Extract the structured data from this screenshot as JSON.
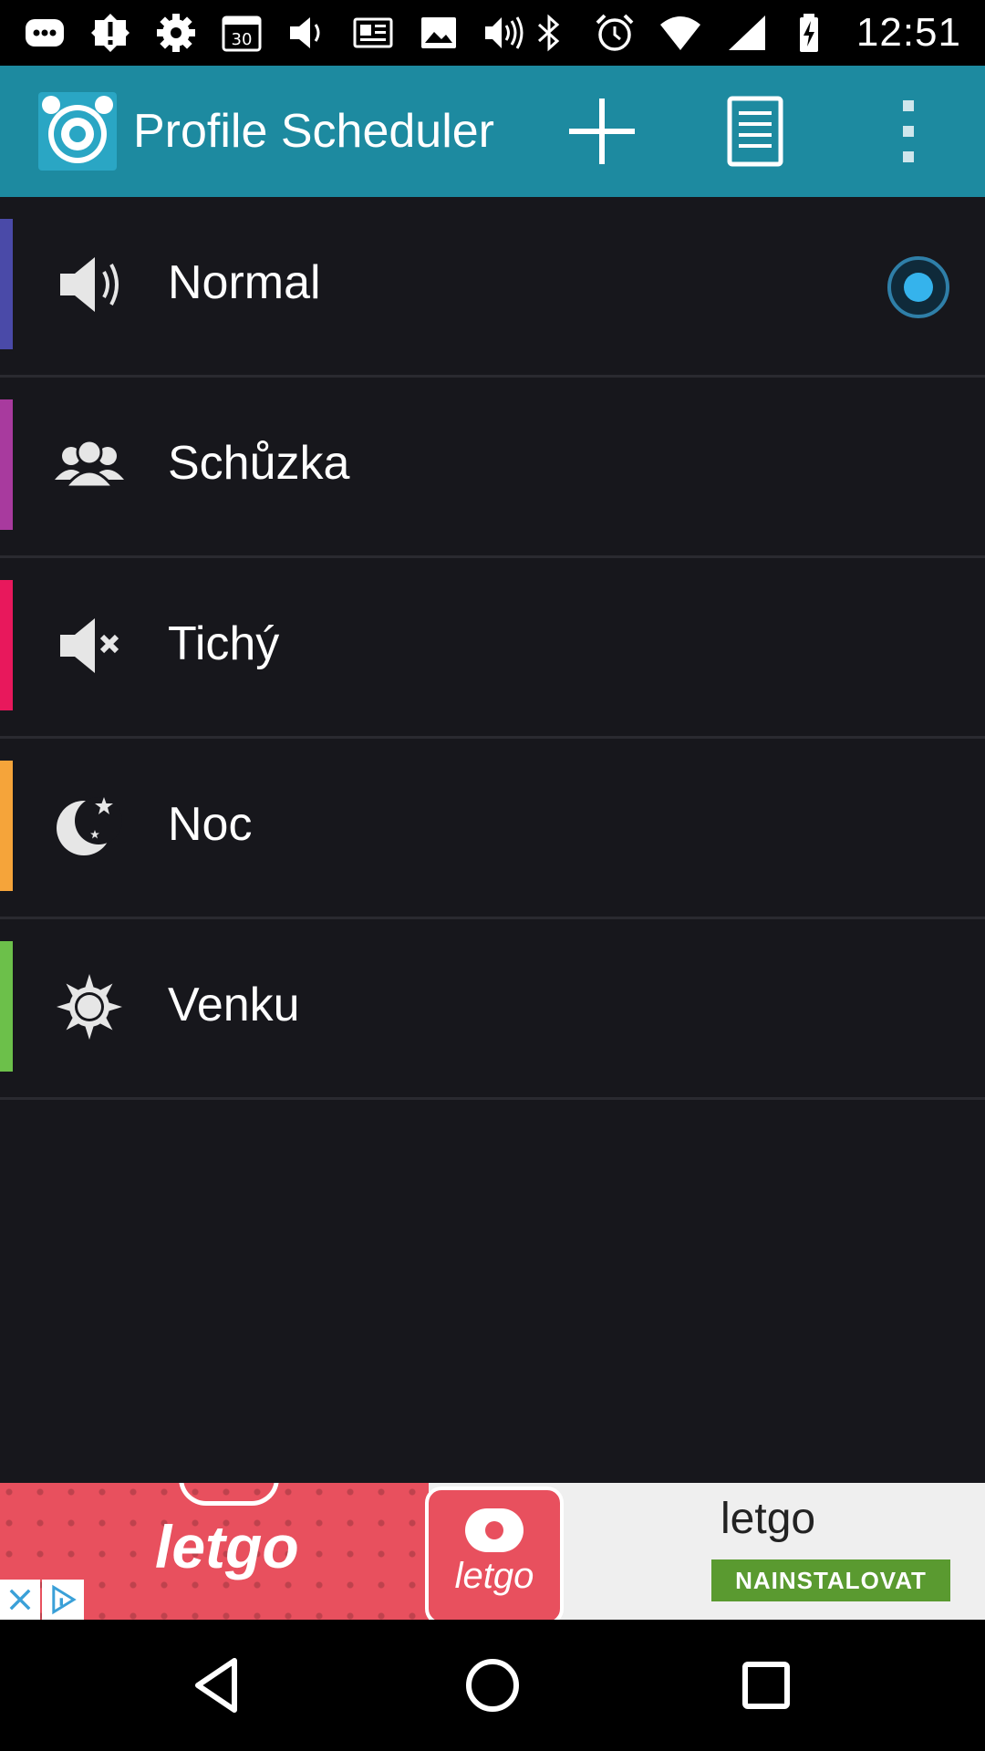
{
  "status_bar": {
    "time": "12:51",
    "left_icons": [
      "messages-icon",
      "alert-icon",
      "settings-icon",
      "calendar-icon",
      "volume-icon",
      "news-icon",
      "image-icon",
      "sound-icon"
    ],
    "right_icons": [
      "bluetooth-icon",
      "alarm-icon",
      "wifi-icon",
      "signal-icon",
      "battery-icon"
    ]
  },
  "app_bar": {
    "title": "Profile Scheduler",
    "actions": [
      "add-icon",
      "document-icon",
      "overflow-menu-icon"
    ],
    "color": "#1d8aa0"
  },
  "profiles": [
    {
      "name": "Normal",
      "icon": "speaker-icon",
      "color": "#4a4aa8",
      "active": true
    },
    {
      "name": "Schůzka",
      "icon": "meeting-icon",
      "color": "#a83a9e",
      "active": false
    },
    {
      "name": "Tichý",
      "icon": "mute-icon",
      "color": "#e8185c",
      "active": false
    },
    {
      "name": "Noc",
      "icon": "moon-icon",
      "color": "#f5a43a",
      "active": false
    },
    {
      "name": "Venku",
      "icon": "sun-icon",
      "color": "#6cc04a",
      "active": false
    }
  ],
  "ad": {
    "brand_big": "letgo",
    "tile_name": "letgo",
    "title": "letgo",
    "cta": "NAINSTALOVAT"
  },
  "nav_bar": {
    "buttons": [
      "back-icon",
      "home-icon",
      "recents-icon"
    ]
  }
}
